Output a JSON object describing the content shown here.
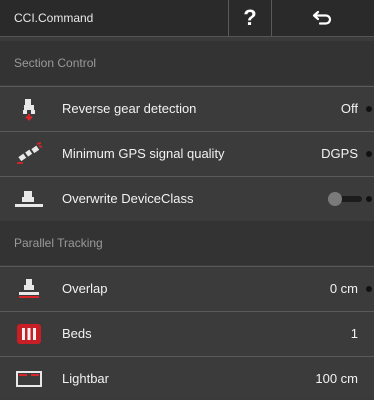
{
  "header": {
    "title": "CCI.Command",
    "help_label": "?"
  },
  "sections": {
    "section_control": "Section Control",
    "parallel_tracking": "Parallel Tracking"
  },
  "rows": {
    "reverse_gear": {
      "label": "Reverse gear detection",
      "value": "Off"
    },
    "gps_quality": {
      "label": "Minimum GPS signal quality",
      "value": "DGPS"
    },
    "device_class": {
      "label": "Overwrite DeviceClass",
      "toggle_on": false
    },
    "overlap": {
      "label": "Overlap",
      "value": "0 cm"
    },
    "beds": {
      "label": "Beds",
      "value": "1"
    },
    "lightbar": {
      "label": "Lightbar",
      "value": "100 cm"
    }
  },
  "colors": {
    "accent_red": "#d9252a",
    "background": "#3b3b3b"
  }
}
